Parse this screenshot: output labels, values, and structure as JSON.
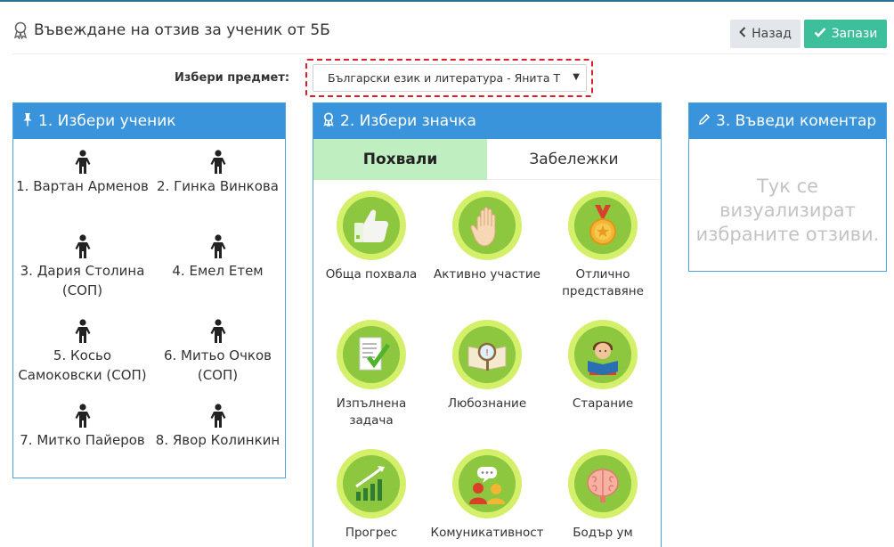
{
  "header": {
    "title": "Въвеждане на отзив за ученик от 5Б",
    "back_label": "Назад",
    "save_label": "Запази"
  },
  "subject": {
    "label": "Избери предмет:",
    "selected": "Български език и литература - Янита Т"
  },
  "students_panel": {
    "title": "1. Избери ученик",
    "students": [
      "1. Вартан Арменов",
      "2. Гинка Винкова",
      "3. Дария Столина (СОП)",
      "4. Емел Етем",
      "5. Косьо Самоковски (СОП)",
      "6. Митьо Очков (СОП)",
      "7. Митко Пайеров",
      "8. Явор Колинкин"
    ]
  },
  "badges_panel": {
    "title": "2. Избери значка",
    "tabs": [
      "Похвали",
      "Забележки"
    ],
    "badges": [
      {
        "label": "Обща похвала",
        "icon": "thumbs-up-icon"
      },
      {
        "label": "Активно участие",
        "icon": "raised-hand-icon"
      },
      {
        "label": "Отлично представяне",
        "icon": "medal-icon"
      },
      {
        "label": "Изпълнена задача",
        "icon": "checked-document-icon"
      },
      {
        "label": "Любознание",
        "icon": "magnifier-book-icon"
      },
      {
        "label": "Старание",
        "icon": "reading-student-icon"
      },
      {
        "label": "Прогрес",
        "icon": "growth-chart-icon"
      },
      {
        "label": "Комуникативност",
        "icon": "chat-people-icon"
      },
      {
        "label": "Бодър ум",
        "icon": "brain-icon"
      }
    ]
  },
  "comment_panel": {
    "title": "3. Въведи коментар",
    "placeholder": "Тук се визуализират избраните отзиви."
  },
  "colors": {
    "panel_header": "#3a94dc",
    "save_button": "#3dbf9c",
    "active_tab": "#bfeec0",
    "badge_green": "#8dc63f",
    "highlight": "#d9202a"
  }
}
